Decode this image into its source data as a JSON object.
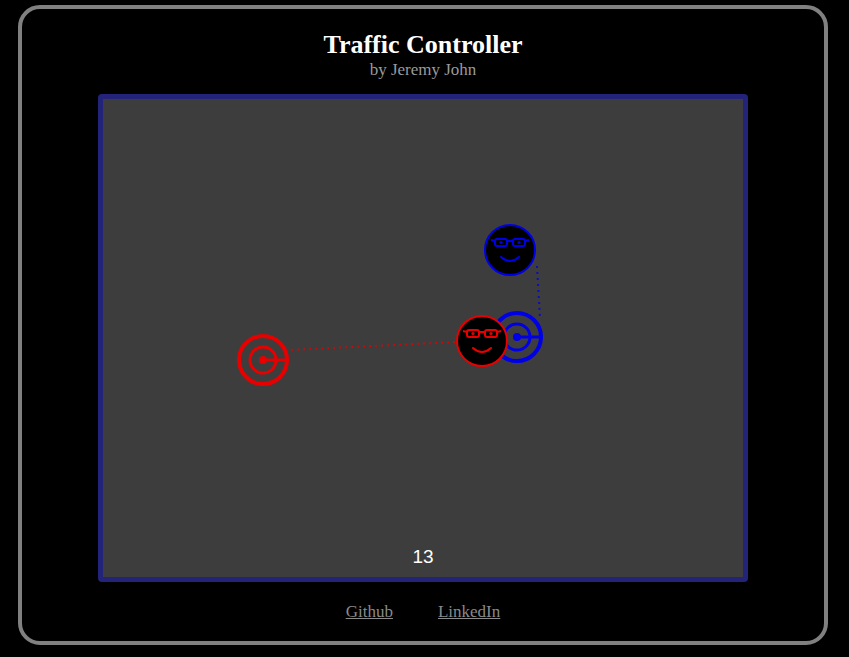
{
  "header": {
    "title": "Traffic Controller",
    "subtitle": "by Jeremy John"
  },
  "game": {
    "score": "13",
    "agents": [
      {
        "color": "#e60000"
      },
      {
        "color": "#0000e6"
      }
    ]
  },
  "links": [
    "Github",
    "LinkedIn"
  ]
}
